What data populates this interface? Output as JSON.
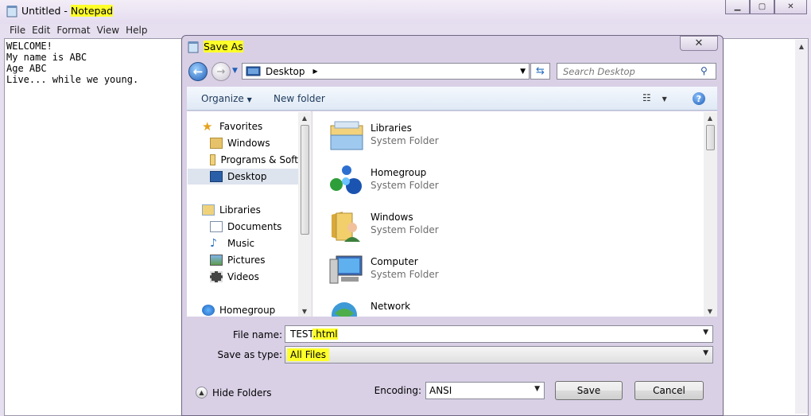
{
  "notepad": {
    "title_doc": "Untitled",
    "title_sep": " - ",
    "title_app": "Notepad",
    "menu": [
      "File",
      "Edit",
      "Format",
      "View",
      "Help"
    ],
    "content": [
      "WELCOME!",
      "My name is ABC",
      "Age ABC",
      "Live... while we young."
    ]
  },
  "dialog": {
    "title": "Save As",
    "address": "Desktop",
    "search_placeholder": "Search Desktop",
    "toolbar": {
      "organize": "Organize",
      "new_folder": "New folder"
    },
    "nav": [
      {
        "label": "Favorites",
        "icon": "star-icon"
      },
      {
        "label": "Windows",
        "icon": "folder-user-icon"
      },
      {
        "label": "Programs & Soft",
        "icon": "folder-icon"
      },
      {
        "label": "Desktop",
        "icon": "desktop-icon"
      },
      {
        "label": "Libraries",
        "icon": "libraries-icon"
      },
      {
        "label": "Documents",
        "icon": "documents-icon"
      },
      {
        "label": "Music",
        "icon": "music-icon"
      },
      {
        "label": "Pictures",
        "icon": "pictures-icon"
      },
      {
        "label": "Videos",
        "icon": "videos-icon"
      },
      {
        "label": "Homegroup",
        "icon": "homegroup-icon"
      }
    ],
    "files": [
      {
        "name": "Libraries",
        "type": "System Folder",
        "icon": "libraries-icon"
      },
      {
        "name": "Homegroup",
        "type": "System Folder",
        "icon": "homegroup-icon"
      },
      {
        "name": "Windows",
        "type": "System Folder",
        "icon": "user-folder-icon"
      },
      {
        "name": "Computer",
        "type": "System Folder",
        "icon": "computer-icon"
      },
      {
        "name": "Network",
        "type": "",
        "icon": "network-icon"
      }
    ],
    "file_name_label": "File name:",
    "file_name_base": "TEST",
    "file_name_ext": ".html",
    "save_type_label": "Save as type:",
    "save_type": "All Files",
    "hide_folders": "Hide Folders",
    "encoding_label": "Encoding:",
    "encoding": "ANSI",
    "save": "Save",
    "cancel": "Cancel"
  }
}
